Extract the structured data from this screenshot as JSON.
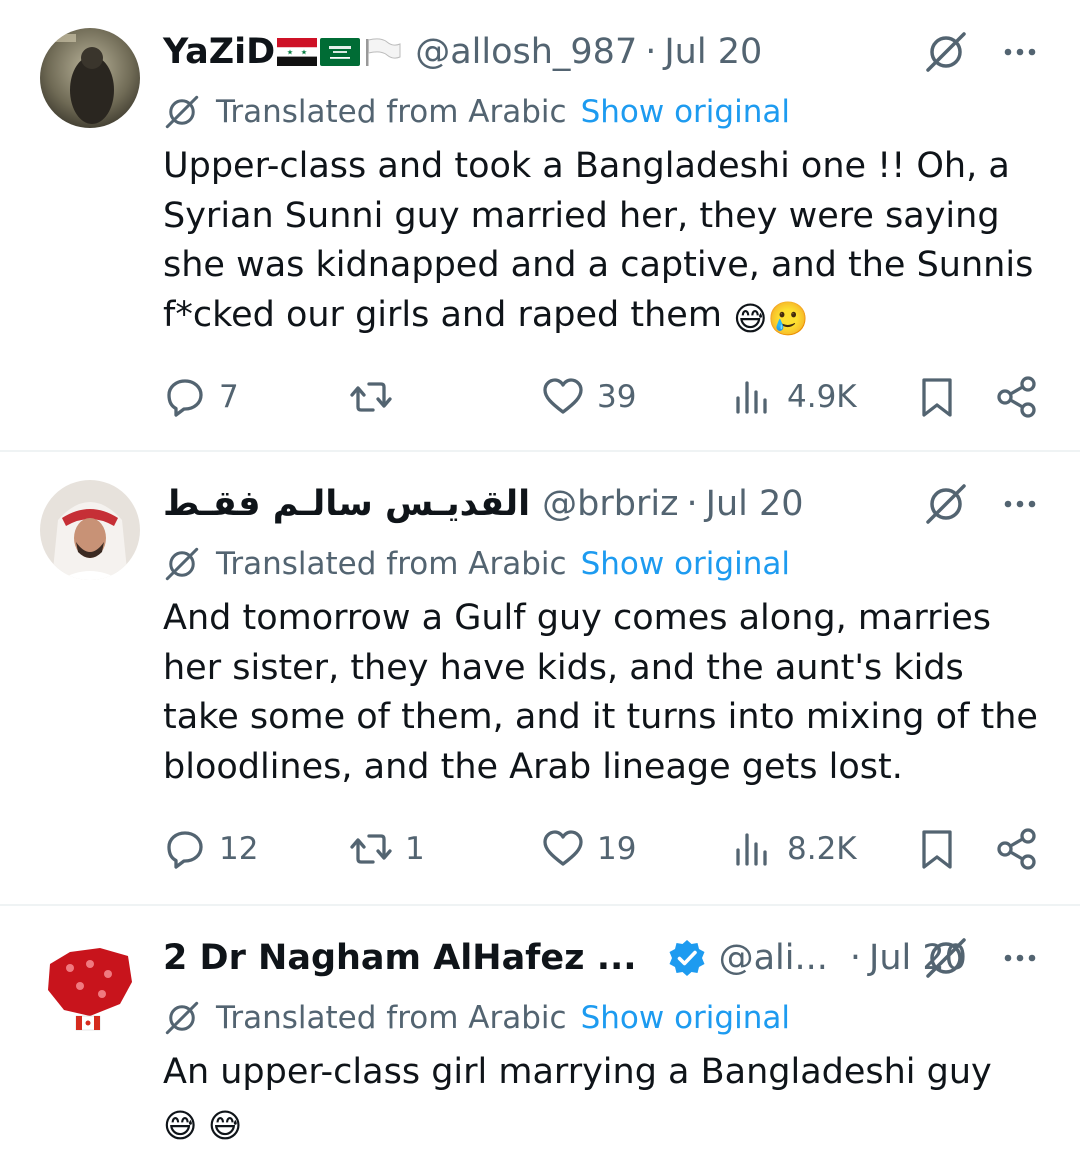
{
  "tweets": [
    {
      "author_name": "YaZiD",
      "handle": "@allosh_987",
      "date": "Jul 20",
      "translated_label": "Translated from Arabic",
      "show_original": "Show original",
      "text": "Upper-class and took a Bangladeshi one !! Oh, a Syrian Sunni guy married her, they were saying she was kidnapped and a captive, and the Sunnis f*cked our girls and raped them",
      "emojis": "😅🥲",
      "replies": "7",
      "retweets": "",
      "likes": "39",
      "views": "4.9K"
    },
    {
      "author_name": "القديـس سالـم فقـط",
      "handle": "@brbriz",
      "date": "Jul 20",
      "translated_label": "Translated from Arabic",
      "show_original": "Show original",
      "text": "And tomorrow a Gulf guy comes along, marries her sister, they have kids, and the aunt's kids take some of them, and it turns into mixing of the bloodlines, and the Arab lineage gets lost.",
      "emojis": "",
      "replies": "12",
      "retweets": "1",
      "likes": "19",
      "views": "8.2K"
    },
    {
      "author_name": "2 Dr Nagham AlHafez ...",
      "handle": "@ali...",
      "date": "Jul 20",
      "translated_label": "Translated from Arabic",
      "show_original": "Show original",
      "text": "An upper-class girl marrying a Bangladeshi guy",
      "emojis": "😅 😅"
    }
  ],
  "colors": {
    "text_primary": "#0f1419",
    "text_secondary": "#536471",
    "link": "#1d9bf0",
    "divider": "#eff3f4"
  },
  "icons": [
    "grok-icon",
    "more-icon",
    "translate-icon",
    "reply-icon",
    "retweet-icon",
    "like-icon",
    "views-icon",
    "bookmark-icon",
    "share-icon",
    "verified-badge-icon",
    "syria-flag-icon",
    "saudi-flag-icon",
    "white-flag-icon"
  ]
}
